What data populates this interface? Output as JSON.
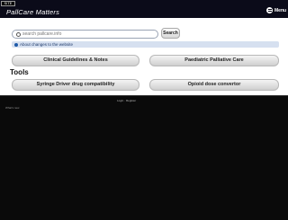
{
  "header": {
    "badge": "SITE",
    "brand": "PallCare Matters",
    "menu_label": "Menu"
  },
  "search": {
    "placeholder": "search pallcare.info",
    "value": "search pallcare.info",
    "button_label": "Search"
  },
  "changes": {
    "label": "About changes to the website"
  },
  "tiles": {
    "clinical": "Clinical Guidelines & Notes",
    "paediatric": "Paediatric Palliative Care",
    "syringe": "Syringe Driver drug compatibility",
    "opioid": "Opioid dose convertor"
  },
  "tools": {
    "heading": "Tools"
  },
  "footer": {
    "left": "",
    "center": "Login · Register",
    "small": "What's new"
  },
  "colors": {
    "appbar": "#0b0b19",
    "accent": "#1e5aa8",
    "changes_bg": "#d6e0f0"
  }
}
